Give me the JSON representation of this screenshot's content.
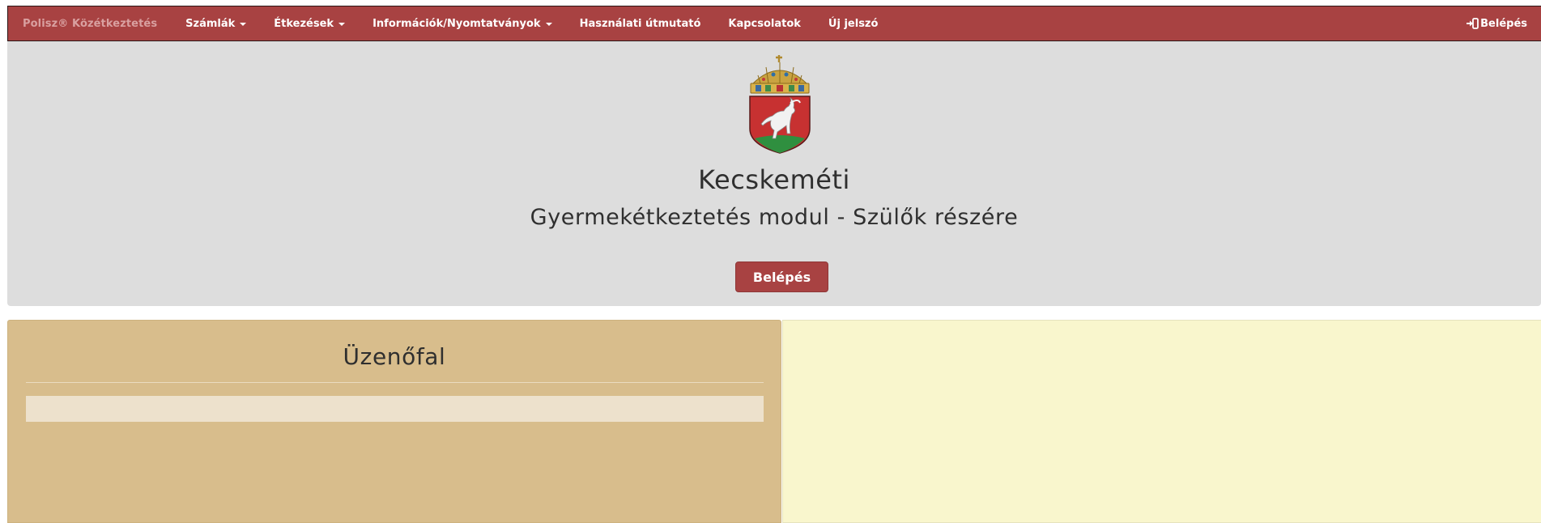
{
  "navbar": {
    "brand": "Polisz® Közétkeztetés",
    "items": [
      {
        "label": "Számlák",
        "dropdown": true
      },
      {
        "label": "Étkezések",
        "dropdown": true
      },
      {
        "label": "Információk/Nyomtatványok",
        "dropdown": true
      },
      {
        "label": "Használati útmutató",
        "dropdown": false
      },
      {
        "label": "Kapcsolatok",
        "dropdown": false
      },
      {
        "label": "Új jelszó",
        "dropdown": false
      }
    ],
    "login_label": "Belépés",
    "login_icon": "sign-in-icon",
    "background_color": "#a84242"
  },
  "hero": {
    "crest_icon": "kecskemet-coat-of-arms",
    "title": "Kecskeméti",
    "subtitle": "Gyermekétkeztetés modul - Szülők részére",
    "button_label": "Belépés"
  },
  "message_wall": {
    "title": "Üzenőfal",
    "background_color": "#d8bd8c"
  },
  "right_panel": {
    "background_color": "#f9f6cd"
  }
}
